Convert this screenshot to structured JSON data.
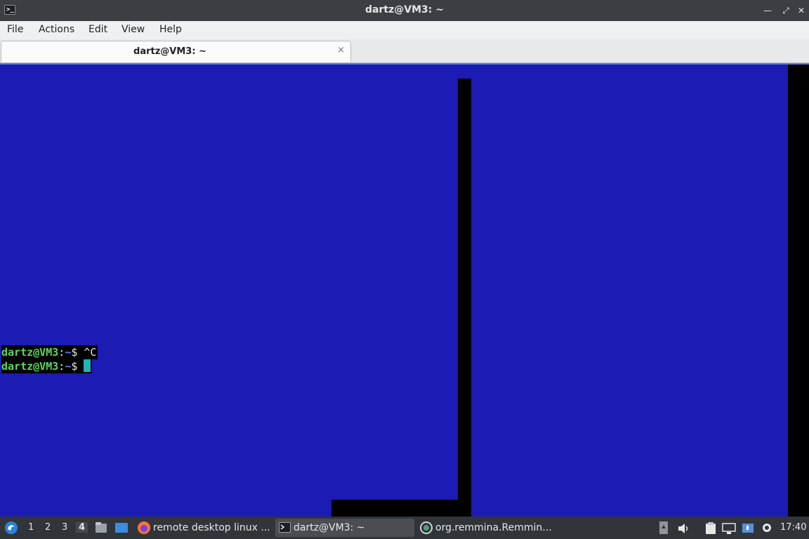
{
  "window": {
    "title": "dartz@VM3: ~",
    "icon": "terminal-icon",
    "controls": [
      "minimize-icon",
      "maximize-icon",
      "close-icon"
    ]
  },
  "menu": {
    "file": "File",
    "actions": "Actions",
    "edit": "Edit",
    "view": "View",
    "help": "Help"
  },
  "tabs": [
    {
      "label": "dartz@VM3: ~",
      "close": "×"
    }
  ],
  "terminal": {
    "background": "#1c1bb4",
    "lines": [
      {
        "prompt": "dartz@VM3",
        "sep": ":",
        "path": "~",
        "symbol": "$ ",
        "text": "^C"
      },
      {
        "prompt": "dartz@VM3",
        "sep": ":",
        "path": "~",
        "symbol": "$ ",
        "text": ""
      }
    ]
  },
  "taskbar": {
    "workspaces": [
      "1",
      "2",
      "3",
      "4"
    ],
    "active_workspace": "4",
    "items": [
      {
        "label": "remote desktop linux ...",
        "icon": "firefox-icon"
      },
      {
        "label": "dartz@VM3: ~",
        "icon": "terminal-icon"
      },
      {
        "label": "org.remmina.Remmin...",
        "icon": "remmina-icon"
      }
    ],
    "clock": "17:40"
  },
  "colors": {
    "prompt": "#5cd85c",
    "path": "#5a8bff",
    "cursor": "#1fb5b5",
    "taskbar": "#313539"
  }
}
